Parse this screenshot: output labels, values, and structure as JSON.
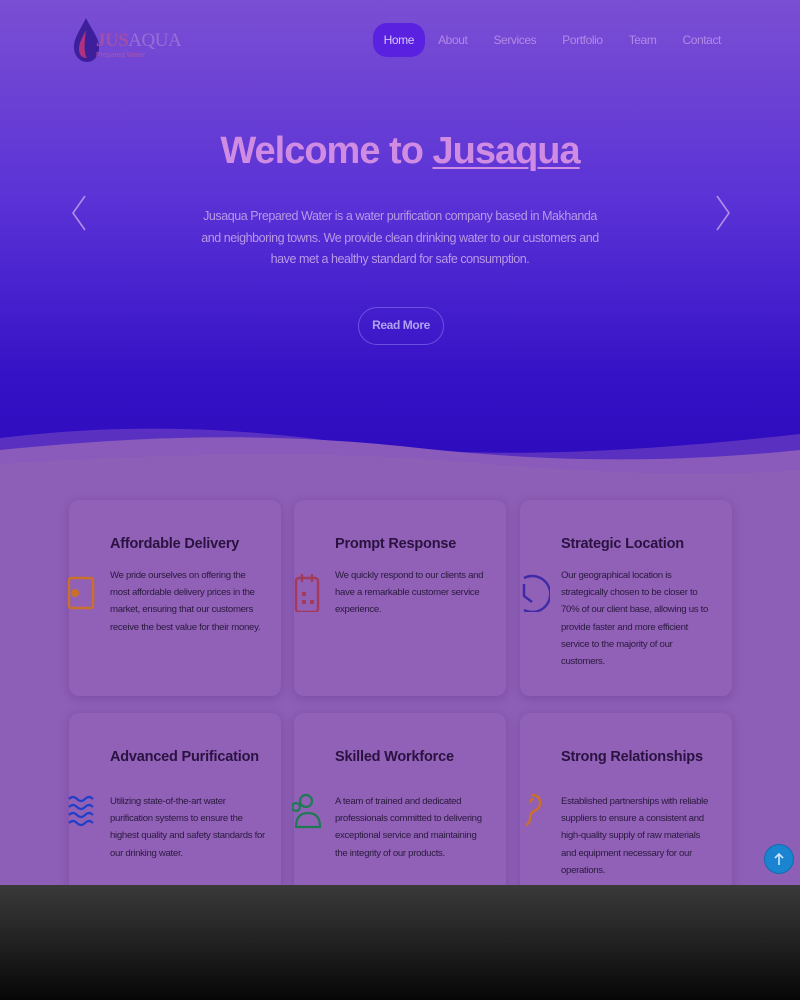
{
  "brand": {
    "name_a": "JUS",
    "name_b": "AQUA",
    "tagline": "Prepared Water"
  },
  "nav": {
    "items": [
      {
        "label": "Home"
      },
      {
        "label": "About"
      },
      {
        "label": "Services"
      },
      {
        "label": "Portfolio"
      },
      {
        "label": "Team"
      },
      {
        "label": "Contact"
      }
    ],
    "active": "Home"
  },
  "hero": {
    "title_prefix": "Welcome to ",
    "title_brand": "Jusaqua",
    "text": "Jusaqua Prepared Water is a water purification company based in Makhanda and neighboring towns. We provide clean drinking water to our customers and have met a healthy standard for safe consumption.",
    "button": "Read More"
  },
  "features": [
    {
      "title": "Affordable Delivery",
      "icon": "cash-icon",
      "color": "#c9702a",
      "text": "We pride ourselves on offering the most affordable delivery prices in the market, ensuring that our customers receive the best value for their money."
    },
    {
      "title": "Prompt Response",
      "icon": "calendar-icon",
      "color": "#a23a5c",
      "text": "We quickly respond to our clients and have a remarkable customer service experience."
    },
    {
      "title": "Strategic Location",
      "icon": "clock-icon",
      "color": "#3e2aa8",
      "text": "Our geographical location is strategically chosen to be closer to 70% of our client base, allowing us to provide faster and more efficient service to the majority of our customers."
    },
    {
      "title": "Advanced Purification",
      "icon": "water-waves-icon",
      "color": "#1f3fc8",
      "text": "Utilizing state-of-the-art water purification systems to ensure the highest quality and safety standards for our drinking water."
    },
    {
      "title": "Skilled Workforce",
      "icon": "people-icon",
      "color": "#1f7a52",
      "text": "A team of trained and dedicated professionals committed to delivering exceptional service and maintaining the integrity of our products."
    },
    {
      "title": "Strong Relationships",
      "icon": "handshake-icon",
      "color": "#c9702a",
      "text": "Established partnerships with reliable suppliers to ensure a consistent and high-quality supply of raw materials and equipment necessary for our operations."
    }
  ]
}
